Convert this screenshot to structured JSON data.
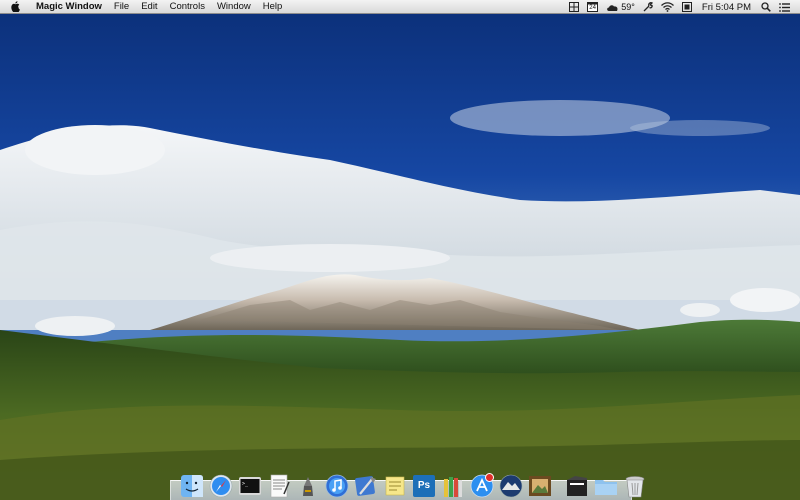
{
  "menubar": {
    "apple_icon": "apple-icon",
    "app_name": "Magic Window",
    "menus": [
      "File",
      "Edit",
      "Controls",
      "Window",
      "Help"
    ],
    "status": {
      "icons": [
        "window-grid-icon",
        "calendar-icon",
        "weather-cloud-icon",
        "battery-wrench-icon",
        "wifi-icon",
        "display-icon",
        "spotlight-search-icon",
        "notification-list-icon"
      ],
      "calendar_day": "24",
      "temperature": "59°",
      "clock": "Fri 5:04 PM"
    }
  },
  "wallpaper": {
    "scene": "mountain-landscape",
    "sky_color": "#0f3d8c",
    "cloud_color": "#eef1f4",
    "forest_color": "#355a1c"
  },
  "dock": {
    "apps": [
      {
        "name": "finder-icon"
      },
      {
        "name": "safari-icon"
      },
      {
        "name": "terminal-icon"
      },
      {
        "name": "textedit-icon"
      },
      {
        "name": "automator-icon"
      },
      {
        "name": "itunes-icon"
      },
      {
        "name": "xcode-icon"
      },
      {
        "name": "stickies-icon"
      },
      {
        "name": "photoshop-icon",
        "label": "Ps"
      },
      {
        "name": "pencils-icon"
      },
      {
        "name": "app-store-icon"
      },
      {
        "name": "el-capitan-icon"
      },
      {
        "name": "photo-frame-icon"
      }
    ],
    "right": [
      {
        "name": "documents-stack-icon"
      },
      {
        "name": "downloads-folder-icon"
      },
      {
        "name": "trash-icon"
      }
    ]
  }
}
